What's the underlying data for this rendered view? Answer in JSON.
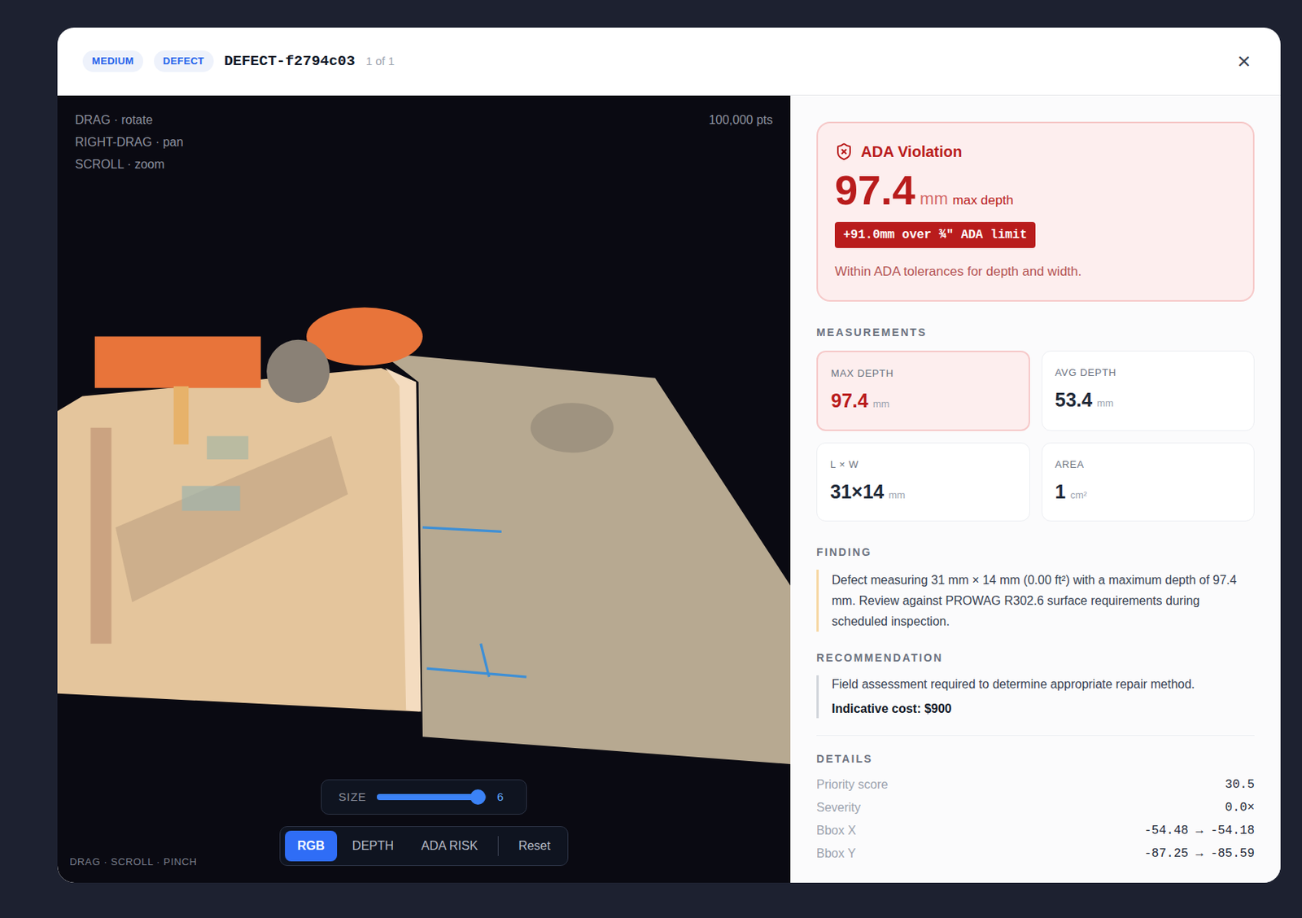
{
  "header": {
    "badges": [
      "MEDIUM",
      "DEFECT"
    ],
    "id": "DEFECT-f2794c03",
    "counter": "1 of 1",
    "close": "×"
  },
  "viewer": {
    "hints": [
      "DRAG · rotate",
      "RIGHT-DRAG · pan",
      "SCROLL · zoom"
    ],
    "points": "100,000 pts",
    "size": {
      "label": "SIZE",
      "value": "6",
      "level": 0.92
    },
    "modes": [
      {
        "label": "RGB",
        "selected": true
      },
      {
        "label": "DEPTH",
        "selected": false
      },
      {
        "label": "ADA RISK",
        "selected": false
      }
    ],
    "reset": "Reset",
    "footer": "DRAG · SCROLL · PINCH"
  },
  "alert": {
    "title": "ADA Violation",
    "value": "97.4",
    "unit": "mm",
    "caption": "max depth",
    "badge": "+91.0mm over ¾″ ADA limit",
    "note": "Within ADA tolerances for depth and width."
  },
  "measurements": {
    "title": "MEASUREMENTS",
    "cards": [
      {
        "label": "MAX DEPTH",
        "value": "97.4",
        "unit": "mm",
        "highlighted": true
      },
      {
        "label": "AVG DEPTH",
        "value": "53.4",
        "unit": "mm",
        "highlighted": false
      },
      {
        "label": "L × W",
        "value": "31×14",
        "unit": "mm",
        "highlighted": false
      },
      {
        "label": "AREA",
        "value": "1",
        "unit": "cm²",
        "highlighted": false
      }
    ]
  },
  "finding": {
    "title": "FINDING",
    "text": "Defect measuring 31 mm × 14 mm (0.00 ft²) with a maximum depth of 97.4 mm. Review against PROWAG R302.6 surface requirements during scheduled inspection."
  },
  "recommendation": {
    "title": "RECOMMENDATION",
    "text": "Field assessment required to determine appropriate repair method.",
    "cost": "Indicative cost: $900"
  },
  "details": {
    "title": "DETAILS",
    "rows": [
      {
        "label": "Priority score",
        "value": "30.5"
      },
      {
        "label": "Severity",
        "value": "0.0×"
      },
      {
        "label": "Bbox X",
        "value": "-54.48 → -54.18"
      },
      {
        "label": "Bbox Y",
        "value": "-87.25 → -85.59"
      }
    ]
  }
}
